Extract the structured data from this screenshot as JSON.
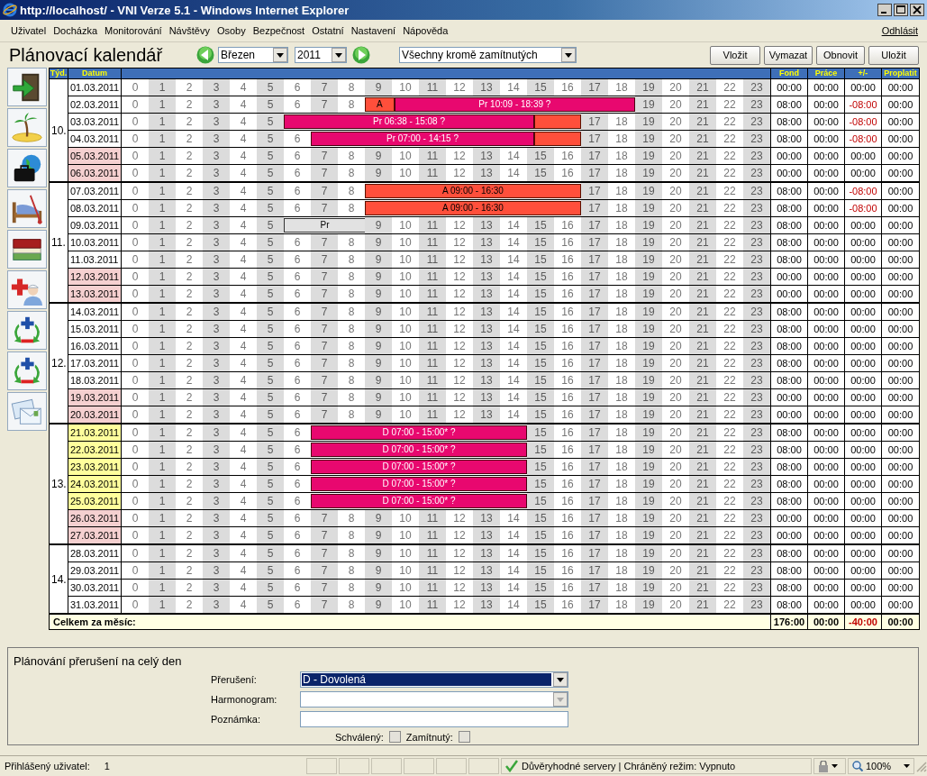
{
  "window": {
    "title": "http://localhost/ - VNI Verze 5.1 - Windows Internet Explorer"
  },
  "menu": {
    "items": [
      "Uživatel",
      "Docházka",
      "Monitorování",
      "Návštěvy",
      "Osoby",
      "Bezpečnost",
      "Ostatní",
      "Nastavení",
      "Nápověda"
    ],
    "logout": "Odhlásit"
  },
  "toolbar": {
    "title": "Plánovací kalendář",
    "month": "Březen",
    "year": "2011",
    "filter": "Všechny kromě zamítnutých",
    "buttons": [
      "Vložit",
      "Vymazat",
      "Obnovit",
      "Uložit"
    ]
  },
  "sidebar_buttons": [
    {
      "kind": "door"
    },
    {
      "kind": "island"
    },
    {
      "kind": "briefcase"
    },
    {
      "kind": "bed"
    },
    {
      "kind": "books"
    },
    {
      "kind": "medical"
    },
    {
      "kind": "plusminus"
    },
    {
      "kind": "plusminus"
    },
    {
      "kind": "envelopes"
    }
  ],
  "calendar": {
    "headers": {
      "week": "Týd.",
      "date": "Datum",
      "fond": "Fond",
      "work": "Práce",
      "diff": "+/-",
      "pay": "Proplatit"
    },
    "weeks": [
      {
        "week": "10.",
        "days": [
          {
            "date": "01.03.2011",
            "kind": "workday",
            "hours": [
              "0",
              "1",
              "2",
              "3",
              "4",
              "5",
              "6",
              "7",
              "8",
              "9",
              "10",
              "11",
              "12",
              "13",
              "14",
              "15",
              "16",
              "17",
              "18",
              "19",
              "20",
              "21",
              "22",
              "23"
            ],
            "fond": "00:00",
            "work": "00:00",
            "diff": "00:00",
            "overdrawn": false,
            "pay": "00:00"
          },
          {
            "date": "02.03.2011",
            "kind": "workday",
            "hours_before": [
              "0",
              "1",
              "2",
              "3",
              "4",
              "5",
              "6",
              "7",
              "8"
            ],
            "bars": [
              {
                "kind": "absence",
                "label": "A"
              },
              {
                "kind": "plan",
                "label": "Pr 10:09 - 18:39 ?"
              }
            ],
            "hours_after": [
              "19",
              "20",
              "21",
              "22",
              "23"
            ],
            "fond": "08:00",
            "work": "00:00",
            "diff": "-08:00",
            "overdrawn": true,
            "pay": "00:00"
          },
          {
            "date": "03.03.2011",
            "kind": "workday",
            "hours_before": [
              "0",
              "1",
              "2",
              "3",
              "4",
              "5"
            ],
            "bars": [
              {
                "kind": "plan",
                "label": "Pr 06:38 - 15:08 ?"
              },
              {
                "kind": "absence"
              }
            ],
            "hours_after": [
              "17",
              "18",
              "19",
              "20",
              "21",
              "22",
              "23"
            ],
            "fond": "08:00",
            "work": "00:00",
            "diff": "-08:00",
            "overdrawn": true,
            "pay": "00:00"
          },
          {
            "date": "04.03.2011",
            "kind": "workday",
            "hours_before": [
              "0",
              "1",
              "2",
              "3",
              "4",
              "5",
              "6"
            ],
            "bars": [
              {
                "kind": "plan",
                "label": "Pr 07:00 - 14:15 ?"
              },
              {
                "kind": "absence"
              }
            ],
            "hours_after": [
              "17",
              "18",
              "19",
              "20",
              "21",
              "22",
              "23"
            ],
            "fond": "08:00",
            "work": "00:00",
            "diff": "-08:00",
            "overdrawn": true,
            "pay": "00:00"
          },
          {
            "date": "05.03.2011",
            "kind": "weekend",
            "hours": [
              "0",
              "1",
              "2",
              "3",
              "4",
              "5",
              "6",
              "7",
              "8",
              "9",
              "10",
              "11",
              "12",
              "13",
              "14",
              "15",
              "16",
              "17",
              "18",
              "19",
              "20",
              "21",
              "22",
              "23"
            ],
            "fond": "00:00",
            "work": "00:00",
            "diff": "00:00",
            "overdrawn": false,
            "pay": "00:00"
          },
          {
            "date": "06.03.2011",
            "kind": "weekend",
            "hours": [
              "0",
              "1",
              "2",
              "3",
              "4",
              "5",
              "6",
              "7",
              "8",
              "9",
              "10",
              "11",
              "12",
              "13",
              "14",
              "15",
              "16",
              "17",
              "18",
              "19",
              "20",
              "21",
              "22",
              "23"
            ],
            "fond": "00:00",
            "work": "00:00",
            "diff": "00:00",
            "overdrawn": false,
            "pay": "00:00"
          }
        ]
      },
      {
        "week": "11.",
        "days": [
          {
            "date": "07.03.2011",
            "kind": "workday",
            "hours_before": [
              "0",
              "1",
              "2",
              "3",
              "4",
              "5",
              "6",
              "7",
              "8"
            ],
            "bars": [
              {
                "kind": "absence",
                "label": "A 09:00 - 16:30"
              }
            ],
            "hours_after": [
              "17",
              "18",
              "19",
              "20",
              "21",
              "22",
              "23"
            ],
            "fond": "08:00",
            "work": "00:00",
            "diff": "-08:00",
            "overdrawn": true,
            "pay": "00:00"
          },
          {
            "date": "08.03.2011",
            "kind": "workday",
            "hours_before": [
              "0",
              "1",
              "2",
              "3",
              "4",
              "5",
              "6",
              "7",
              "8"
            ],
            "bars": [
              {
                "kind": "absence",
                "label": "A 09:00 - 16:30"
              }
            ],
            "hours_after": [
              "17",
              "18",
              "19",
              "20",
              "21",
              "22",
              "23"
            ],
            "fond": "08:00",
            "work": "00:00",
            "diff": "-08:00",
            "overdrawn": true,
            "pay": "00:00"
          },
          {
            "date": "09.03.2011",
            "kind": "workday",
            "hours_before": [
              "0",
              "1",
              "2",
              "3",
              "4",
              "5"
            ],
            "bars": [
              {
                "kind": "draft",
                "label": "Pr"
              }
            ],
            "hours_after": [
              "9",
              "10",
              "11",
              "12",
              "13",
              "14",
              "15",
              "16",
              "17",
              "18",
              "19",
              "20",
              "21",
              "22",
              "23"
            ],
            "fond": "08:00",
            "work": "00:00",
            "diff": "00:00",
            "overdrawn": false,
            "pay": "00:00"
          },
          {
            "date": "10.03.2011",
            "kind": "workday",
            "hours": [
              "0",
              "1",
              "2",
              "3",
              "4",
              "5",
              "6",
              "7",
              "8",
              "9",
              "10",
              "11",
              "12",
              "13",
              "14",
              "15",
              "16",
              "17",
              "18",
              "19",
              "20",
              "21",
              "22",
              "23"
            ],
            "fond": "08:00",
            "work": "00:00",
            "diff": "00:00",
            "overdrawn": false,
            "pay": "00:00"
          },
          {
            "date": "11.03.2011",
            "kind": "workday",
            "hours": [
              "0",
              "1",
              "2",
              "3",
              "4",
              "5",
              "6",
              "7",
              "8",
              "9",
              "10",
              "11",
              "12",
              "13",
              "14",
              "15",
              "16",
              "17",
              "18",
              "19",
              "20",
              "21",
              "22",
              "23"
            ],
            "fond": "08:00",
            "work": "00:00",
            "diff": "00:00",
            "overdrawn": false,
            "pay": "00:00"
          },
          {
            "date": "12.03.2011",
            "kind": "weekend",
            "hours": [
              "0",
              "1",
              "2",
              "3",
              "4",
              "5",
              "6",
              "7",
              "8",
              "9",
              "10",
              "11",
              "12",
              "13",
              "14",
              "15",
              "16",
              "17",
              "18",
              "19",
              "20",
              "21",
              "22",
              "23"
            ],
            "fond": "00:00",
            "work": "00:00",
            "diff": "00:00",
            "overdrawn": false,
            "pay": "00:00"
          },
          {
            "date": "13.03.2011",
            "kind": "weekend",
            "hours": [
              "0",
              "1",
              "2",
              "3",
              "4",
              "5",
              "6",
              "7",
              "8",
              "9",
              "10",
              "11",
              "12",
              "13",
              "14",
              "15",
              "16",
              "17",
              "18",
              "19",
              "20",
              "21",
              "22",
              "23"
            ],
            "fond": "00:00",
            "work": "00:00",
            "diff": "00:00",
            "overdrawn": false,
            "pay": "00:00"
          }
        ]
      },
      {
        "week": "12.",
        "days": [
          {
            "date": "14.03.2011",
            "kind": "workday",
            "hours": [
              "0",
              "1",
              "2",
              "3",
              "4",
              "5",
              "6",
              "7",
              "8",
              "9",
              "10",
              "11",
              "12",
              "13",
              "14",
              "15",
              "16",
              "17",
              "18",
              "19",
              "20",
              "21",
              "22",
              "23"
            ],
            "fond": "08:00",
            "work": "00:00",
            "diff": "00:00",
            "overdrawn": false,
            "pay": "00:00"
          },
          {
            "date": "15.03.2011",
            "kind": "workday",
            "hours": [
              "0",
              "1",
              "2",
              "3",
              "4",
              "5",
              "6",
              "7",
              "8",
              "9",
              "10",
              "11",
              "12",
              "13",
              "14",
              "15",
              "16",
              "17",
              "18",
              "19",
              "20",
              "21",
              "22",
              "23"
            ],
            "fond": "08:00",
            "work": "00:00",
            "diff": "00:00",
            "overdrawn": false,
            "pay": "00:00"
          },
          {
            "date": "16.03.2011",
            "kind": "workday",
            "hours": [
              "0",
              "1",
              "2",
              "3",
              "4",
              "5",
              "6",
              "7",
              "8",
              "9",
              "10",
              "11",
              "12",
              "13",
              "14",
              "15",
              "16",
              "17",
              "18",
              "19",
              "20",
              "21",
              "22",
              "23"
            ],
            "fond": "08:00",
            "work": "00:00",
            "diff": "00:00",
            "overdrawn": false,
            "pay": "00:00"
          },
          {
            "date": "17.03.2011",
            "kind": "workday",
            "hours": [
              "0",
              "1",
              "2",
              "3",
              "4",
              "5",
              "6",
              "7",
              "8",
              "9",
              "10",
              "11",
              "12",
              "13",
              "14",
              "15",
              "16",
              "17",
              "18",
              "19",
              "20",
              "21",
              "22",
              "23"
            ],
            "fond": "08:00",
            "work": "00:00",
            "diff": "00:00",
            "overdrawn": false,
            "pay": "00:00"
          },
          {
            "date": "18.03.2011",
            "kind": "workday",
            "hours": [
              "0",
              "1",
              "2",
              "3",
              "4",
              "5",
              "6",
              "7",
              "8",
              "9",
              "10",
              "11",
              "12",
              "13",
              "14",
              "15",
              "16",
              "17",
              "18",
              "19",
              "20",
              "21",
              "22",
              "23"
            ],
            "fond": "08:00",
            "work": "00:00",
            "diff": "00:00",
            "overdrawn": false,
            "pay": "00:00"
          },
          {
            "date": "19.03.2011",
            "kind": "weekend",
            "hours": [
              "0",
              "1",
              "2",
              "3",
              "4",
              "5",
              "6",
              "7",
              "8",
              "9",
              "10",
              "11",
              "12",
              "13",
              "14",
              "15",
              "16",
              "17",
              "18",
              "19",
              "20",
              "21",
              "22",
              "23"
            ],
            "fond": "00:00",
            "work": "00:00",
            "diff": "00:00",
            "overdrawn": false,
            "pay": "00:00"
          },
          {
            "date": "20.03.2011",
            "kind": "weekend",
            "hours": [
              "0",
              "1",
              "2",
              "3",
              "4",
              "5",
              "6",
              "7",
              "8",
              "9",
              "10",
              "11",
              "12",
              "13",
              "14",
              "15",
              "16",
              "17",
              "18",
              "19",
              "20",
              "21",
              "22",
              "23"
            ],
            "fond": "00:00",
            "work": "00:00",
            "diff": "00:00",
            "overdrawn": false,
            "pay": "00:00"
          }
        ]
      },
      {
        "week": "13.",
        "days": [
          {
            "date": "21.03.2011",
            "kind": "vacation",
            "hours_before": [
              "0",
              "1",
              "2",
              "3",
              "4",
              "5",
              "6"
            ],
            "bars": [
              {
                "kind": "plan",
                "label": "D 07:00 - 15:00* ?"
              }
            ],
            "hours_after": [
              "15",
              "16",
              "17",
              "18",
              "19",
              "20",
              "21",
              "22",
              "23"
            ],
            "fond": "08:00",
            "work": "00:00",
            "diff": "00:00",
            "overdrawn": false,
            "pay": "00:00"
          },
          {
            "date": "22.03.2011",
            "kind": "vacation",
            "hours_before": [
              "0",
              "1",
              "2",
              "3",
              "4",
              "5",
              "6"
            ],
            "bars": [
              {
                "kind": "plan",
                "label": "D 07:00 - 15:00* ?"
              }
            ],
            "hours_after": [
              "15",
              "16",
              "17",
              "18",
              "19",
              "20",
              "21",
              "22",
              "23"
            ],
            "fond": "08:00",
            "work": "00:00",
            "diff": "00:00",
            "overdrawn": false,
            "pay": "00:00"
          },
          {
            "date": "23.03.2011",
            "kind": "vacation",
            "hours_before": [
              "0",
              "1",
              "2",
              "3",
              "4",
              "5",
              "6"
            ],
            "bars": [
              {
                "kind": "plan",
                "label": "D 07:00 - 15:00* ?"
              }
            ],
            "hours_after": [
              "15",
              "16",
              "17",
              "18",
              "19",
              "20",
              "21",
              "22",
              "23"
            ],
            "fond": "08:00",
            "work": "00:00",
            "diff": "00:00",
            "overdrawn": false,
            "pay": "00:00"
          },
          {
            "date": "24.03.2011",
            "kind": "vacation",
            "hours_before": [
              "0",
              "1",
              "2",
              "3",
              "4",
              "5",
              "6"
            ],
            "bars": [
              {
                "kind": "plan",
                "label": "D 07:00 - 15:00* ?"
              }
            ],
            "hours_after": [
              "15",
              "16",
              "17",
              "18",
              "19",
              "20",
              "21",
              "22",
              "23"
            ],
            "fond": "08:00",
            "work": "00:00",
            "diff": "00:00",
            "overdrawn": false,
            "pay": "00:00"
          },
          {
            "date": "25.03.2011",
            "kind": "vacation",
            "hours_before": [
              "0",
              "1",
              "2",
              "3",
              "4",
              "5",
              "6"
            ],
            "bars": [
              {
                "kind": "plan",
                "label": "D 07:00 - 15:00* ?"
              }
            ],
            "hours_after": [
              "15",
              "16",
              "17",
              "18",
              "19",
              "20",
              "21",
              "22",
              "23"
            ],
            "fond": "08:00",
            "work": "00:00",
            "diff": "00:00",
            "overdrawn": false,
            "pay": "00:00"
          },
          {
            "date": "26.03.2011",
            "kind": "weekend",
            "hours": [
              "0",
              "1",
              "2",
              "3",
              "4",
              "5",
              "6",
              "7",
              "8",
              "9",
              "10",
              "11",
              "12",
              "13",
              "14",
              "15",
              "16",
              "17",
              "18",
              "19",
              "20",
              "21",
              "22",
              "23"
            ],
            "fond": "00:00",
            "work": "00:00",
            "diff": "00:00",
            "overdrawn": false,
            "pay": "00:00"
          },
          {
            "date": "27.03.2011",
            "kind": "weekend",
            "hours": [
              "0",
              "1",
              "2",
              "3",
              "4",
              "5",
              "6",
              "7",
              "8",
              "9",
              "10",
              "11",
              "12",
              "13",
              "14",
              "15",
              "16",
              "17",
              "18",
              "19",
              "20",
              "21",
              "22",
              "23"
            ],
            "fond": "00:00",
            "work": "00:00",
            "diff": "00:00",
            "overdrawn": false,
            "pay": "00:00"
          }
        ]
      },
      {
        "week": "14.",
        "days": [
          {
            "date": "28.03.2011",
            "kind": "workday",
            "hours": [
              "0",
              "1",
              "2",
              "3",
              "4",
              "5",
              "6",
              "7",
              "8",
              "9",
              "10",
              "11",
              "12",
              "13",
              "14",
              "15",
              "16",
              "17",
              "18",
              "19",
              "20",
              "21",
              "22",
              "23"
            ],
            "fond": "08:00",
            "work": "00:00",
            "diff": "00:00",
            "overdrawn": false,
            "pay": "00:00"
          },
          {
            "date": "29.03.2011",
            "kind": "workday",
            "hours": [
              "0",
              "1",
              "2",
              "3",
              "4",
              "5",
              "6",
              "7",
              "8",
              "9",
              "10",
              "11",
              "12",
              "13",
              "14",
              "15",
              "16",
              "17",
              "18",
              "19",
              "20",
              "21",
              "22",
              "23"
            ],
            "fond": "08:00",
            "work": "00:00",
            "diff": "00:00",
            "overdrawn": false,
            "pay": "00:00"
          },
          {
            "date": "30.03.2011",
            "kind": "workday",
            "hours": [
              "0",
              "1",
              "2",
              "3",
              "4",
              "5",
              "6",
              "7",
              "8",
              "9",
              "10",
              "11",
              "12",
              "13",
              "14",
              "15",
              "16",
              "17",
              "18",
              "19",
              "20",
              "21",
              "22",
              "23"
            ],
            "fond": "08:00",
            "work": "00:00",
            "diff": "00:00",
            "overdrawn": false,
            "pay": "00:00"
          },
          {
            "date": "31.03.2011",
            "kind": "workday",
            "hours": [
              "0",
              "1",
              "2",
              "3",
              "4",
              "5",
              "6",
              "7",
              "8",
              "9",
              "10",
              "11",
              "12",
              "13",
              "14",
              "15",
              "16",
              "17",
              "18",
              "19",
              "20",
              "21",
              "22",
              "23"
            ],
            "fond": "08:00",
            "work": "00:00",
            "diff": "00:00",
            "overdrawn": false,
            "pay": "00:00"
          }
        ]
      }
    ],
    "total": {
      "label": "Celkem za měsíc:",
      "fond": "176:00",
      "work": "00:00",
      "diff": "-40:00",
      "overdrawn": true,
      "pay": "00:00"
    }
  },
  "planning_panel": {
    "title": "Plánování přerušení na celý den",
    "fields": [
      {
        "kind": "select",
        "label": "Přerušení:",
        "value": "D - Dovolená",
        "focused": true,
        "disabled": false
      },
      {
        "kind": "select",
        "label": "Harmonogram:",
        "focused": false,
        "disabled": true
      },
      {
        "kind": "text",
        "label": "Poznámka:",
        "focused": false,
        "disabled": false
      }
    ],
    "checkboxes": [
      {
        "label": "Schválený:",
        "checked": false
      },
      {
        "label": "Zamítnutý:",
        "checked": false
      }
    ]
  },
  "status_bar": {
    "user_label": "Přihlášený uživatel:",
    "user": "1",
    "zone": "Důvěryhodné servery | Chráněný režim: Vypnuto",
    "zoom": "100%"
  }
}
